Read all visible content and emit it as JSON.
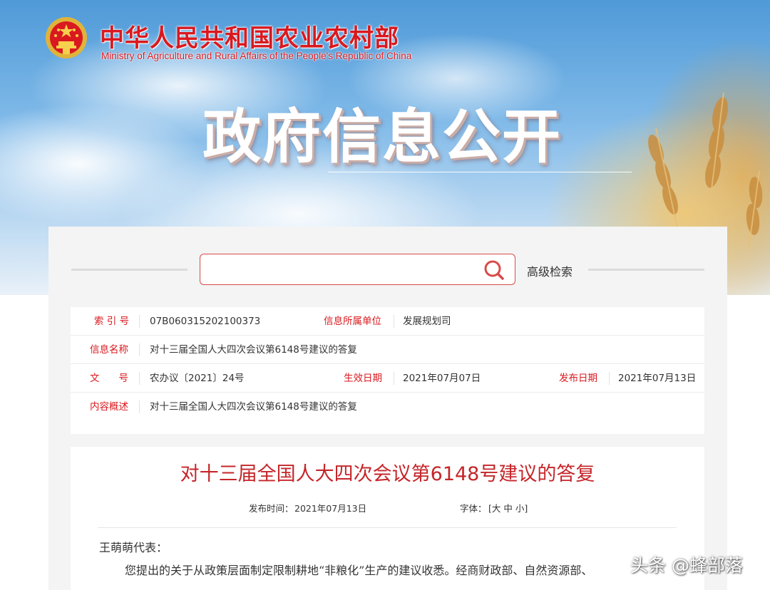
{
  "header": {
    "ministry_name_cn": "中华人民共和国农业农村部",
    "ministry_name_en": "Ministry of Agriculture and Rural Affairs of the People's Republic of China",
    "banner_title": "政府信息公开",
    "emblem_icon": "national-emblem-icon"
  },
  "search": {
    "value": "",
    "placeholder": "",
    "advanced_label": "高级检索",
    "icon": "search-icon"
  },
  "info": {
    "index_label": "索 引 号",
    "index_value": "07B060315202100373",
    "unit_label": "信息所属单位",
    "unit_value": "发展规划司",
    "name_label": "信息名称",
    "name_value": "对十三届全国人大四次会议第6148号建议的答复",
    "doc_label": "文　　号",
    "doc_value": "农办议〔2021〕24号",
    "effective_label": "生效日期",
    "effective_value": "2021年07月07日",
    "publish_label": "发布日期",
    "publish_value": "2021年07月13日",
    "summary_label": "内容概述",
    "summary_value": "对十三届全国人大四次会议第6148号建议的答复"
  },
  "article": {
    "title": "对十三届全国人大四次会议第6148号建议的答复",
    "publish_time_label": "发布时间：",
    "publish_time_value": "2021年07月13日",
    "font_label": "字体：",
    "font_open": "[",
    "font_large": "大",
    "font_medium": "中",
    "font_small": "小",
    "font_close": "]",
    "salutation": "王萌萌代表：",
    "body_first_line": "您提出的关于从政策层面制定限制耕地“非粮化”生产的建议收悉。经商财政部、自然资源部、"
  },
  "watermark": "头条 @蜂部落",
  "colors": {
    "brand_red": "#d9191f",
    "title_red": "#c5262a",
    "panel_bg": "#f4f4f4"
  }
}
